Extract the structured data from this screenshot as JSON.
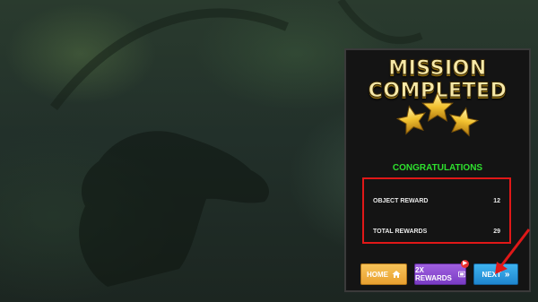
{
  "panel": {
    "title": "MISSION COMPLETED",
    "stars_earned": 3,
    "congratulations": "CONGRATULATIONS",
    "rewards": [
      {
        "label": "OBJECT REWARD",
        "value": "12"
      },
      {
        "label": "TOTAL REWARDS",
        "value": "29"
      }
    ]
  },
  "buttons": {
    "home": "HOME",
    "double": "2X REWARDS",
    "next": "NEXT"
  },
  "colors": {
    "title": "#f7e9a8",
    "congrats": "#2ee02e",
    "highlight": "#e01818",
    "home": "#f0b040",
    "double": "#8a48d4",
    "next": "#2a9ee0"
  }
}
